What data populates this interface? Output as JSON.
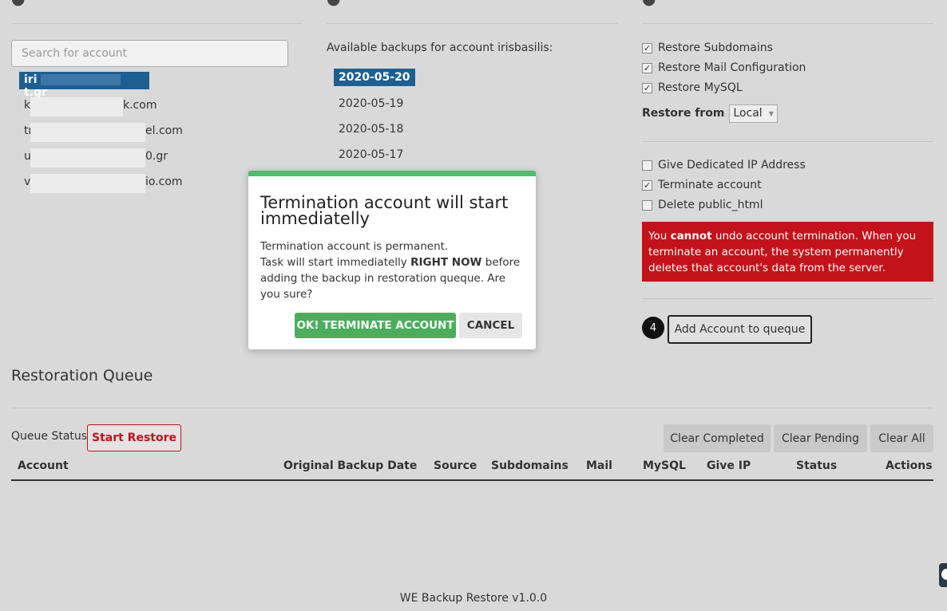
{
  "search": {
    "placeholder": "Search for account"
  },
  "accounts": [
    {
      "prefix": "iri",
      "suffix": "t.gr",
      "selected": true
    },
    {
      "prefix": "ku",
      "suffix": "k.com"
    },
    {
      "prefix": "tr",
      "suffix": "el.com"
    },
    {
      "prefix": "u",
      "suffix": "0.gr"
    },
    {
      "prefix": "vi",
      "suffix": "io.com"
    }
  ],
  "backups": {
    "heading": "Available backups for account irisbasilis:",
    "dates": [
      "2020-05-20",
      "2020-05-19",
      "2020-05-18",
      "2020-05-17"
    ]
  },
  "options": {
    "restore_subdomains": "Restore Subdomains",
    "restore_mail": "Restore Mail Configuration",
    "restore_mysql": "Restore MySQL",
    "restore_from_label": "Restore from",
    "restore_from_value": "Local",
    "dedicated_ip": "Give Dedicated IP Address",
    "terminate_account": "Terminate account",
    "delete_public_html": "Delete public_html"
  },
  "warning": {
    "part1": "You ",
    "strong": "cannot",
    "part2": " undo account termination. When you terminate an account, the system permanently deletes that account's data from the server."
  },
  "add_step": {
    "number": "4",
    "label": "Add Account to queque"
  },
  "queue": {
    "title": "Restoration Queue",
    "status_label": "Queue Status:",
    "start_label": "Start Restore",
    "clear_completed": "Clear Completed",
    "clear_pending": "Clear Pending",
    "clear_all": "Clear All",
    "columns": {
      "account": "Account",
      "backup_date": "Original Backup Date",
      "source": "Source",
      "subdomains": "Subdomains",
      "mail": "Mail",
      "mysql": "MySQL",
      "give_ip": "Give IP",
      "status": "Status",
      "actions": "Actions"
    }
  },
  "footer": "WE Backup Restore v1.0.0",
  "modal": {
    "title": "Termination account will start immediatelly",
    "line1": "Termination account is permanent.",
    "line2_pre": "Task will start immediatelly ",
    "line2_strong": "RIGHT NOW",
    "line2_post": " before adding the backup in restoration queque. Are you sure?",
    "ok_label": "OK! TERMINATE ACCOUNT",
    "cancel_label": "CANCEL"
  },
  "colors": {
    "accent": "#1e5f91",
    "danger": "#c4121a",
    "success": "#4cae5c"
  }
}
